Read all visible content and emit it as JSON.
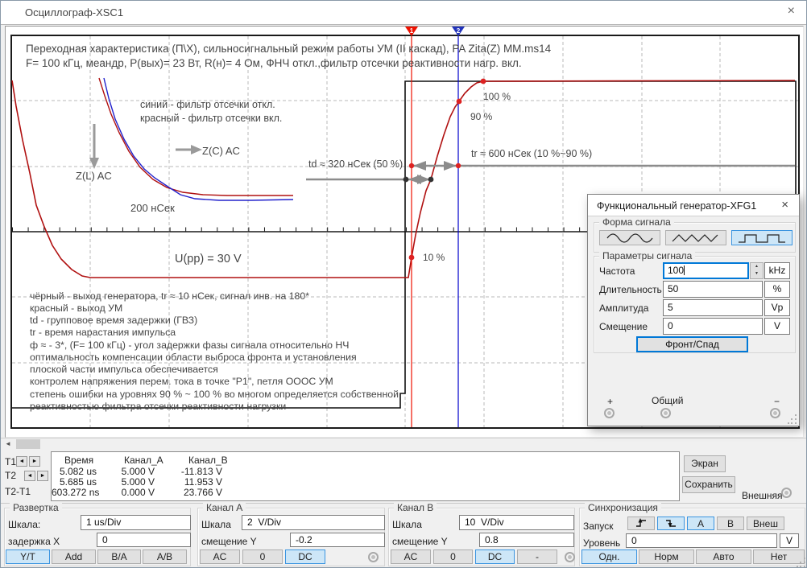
{
  "window": {
    "title": "Осциллограф-XSC1",
    "close": "×"
  },
  "scope": {
    "annotations": {
      "title_line1": "Переходная характеристика (П\\Х), сильносигнальный режим работы УМ (II каскад), PA Zita(Z) MM.ms14",
      "title_line2": "F= 100 кГц, меандр, P(вых)= 23 Вт, R(н)= 4 Ом, ФНЧ откл.,фильтр отсечки реактивности нагр. вкл.",
      "legend_blue": "синий - фильтр отсечки откл.",
      "legend_red": "красный - фильтр отсечки вкл.",
      "zc_label": "Z(C) AC",
      "zl_label": "Z(L) AC",
      "inset_time": "200 нСек",
      "td_label": "td ≈ 320 нСек (50 %)",
      "tr_label": "tr ≈ 600 нСек (10 %~90 %)",
      "p100": "100 %",
      "p90": "90 %",
      "p10": "10 %",
      "upp": "U(pp) = 30 V",
      "notes": [
        "чёрный - выход генератора, tr ≈ 10 нСек, сигнал инв. на 180*",
        "красный - выход УМ",
        "td - групповое время задержки (ГВЗ)",
        "tr - время нарастания импульса",
        "ф ≈ - 3*, (F= 100 кГц) - угол задержки фазы сигнала относительно НЧ",
        "оптимальность компенсации области выброса фронта и установления",
        "плоской части импульса обеспечивается",
        "контролем напряжения перем. тока в точке \"P1\", петля ОООС УМ",
        "степень ошибки на уровнях 90 % ~ 100 % во многом определяется собственной",
        "реактивностью фильтра отсечки реактивности нагрузки"
      ]
    },
    "cursors": {
      "c1": "1",
      "c2": "2"
    }
  },
  "measurements": {
    "headers": [
      "Время",
      "Канал_A",
      "Канал_B"
    ],
    "row_labels": [
      "T1",
      "T2",
      "T2-T1"
    ],
    "rows": [
      {
        "time": "5.082 us",
        "a": "5.000 V",
        "b": "-11.813 V"
      },
      {
        "time": "5.685 us",
        "a": "5.000 V",
        "b": "11.953 V"
      },
      {
        "time": "603.272 ns",
        "a": "0.000 V",
        "b": "23.766 V"
      }
    ],
    "screen_button": "Экран",
    "save_button": "Сохранить",
    "external_label": "Внешняя"
  },
  "timebase": {
    "group": "Развертка",
    "scale_label": "Шкала:",
    "scale_value": "1 us/Div",
    "xpos_label": "задержка X",
    "xpos_value": "0",
    "buttons": [
      "Y/T",
      "Add",
      "B/A",
      "A/B"
    ]
  },
  "channel_a": {
    "group": "Канал А",
    "scale_label": "Шкала",
    "scale_value": "2  V/Div",
    "offset_label": "смещение Y",
    "offset_value": "-0.2",
    "buttons": [
      "AC",
      "0",
      "DC"
    ]
  },
  "channel_b": {
    "group": "Канал B",
    "scale_label": "Шкала",
    "scale_value": "10  V/Div",
    "offset_label": "смещение Y",
    "offset_value": "0.8",
    "buttons": [
      "AC",
      "0",
      "DC",
      "-"
    ]
  },
  "trigger": {
    "group": "Синхронизация",
    "start_label": "Запуск",
    "source_buttons": [
      "A",
      "B",
      "Внеш"
    ],
    "level_label": "Уровень",
    "level_value": "0",
    "level_unit": "V",
    "modes": [
      "Одн.",
      "Норм",
      "Авто",
      "Нет"
    ]
  },
  "generator": {
    "title": "Функциональный генератор-XFG1",
    "close": "×",
    "waveform_group": "Форма сигнала",
    "params_group": "Параметры сигнала",
    "rows": [
      {
        "label": "Частота",
        "value": "100",
        "unit": "kHz"
      },
      {
        "label": "Длительность",
        "value": "50",
        "unit": "%"
      },
      {
        "label": "Амплитуда",
        "value": "5",
        "unit": "Vp"
      },
      {
        "label": "Смещение",
        "value": "0",
        "unit": "V"
      }
    ],
    "edge_button": "Фронт/Спад",
    "terminals": {
      "plus": "+",
      "common": "Общий",
      "minus": "−"
    }
  },
  "icons": {
    "scroll_left": "◄",
    "t_left": "◄",
    "t_right": "►",
    "spin_up": "▲",
    "spin_down": "▼",
    "waveforms": [
      "sine-wave",
      "triangle-wave",
      "square-wave"
    ],
    "edges": [
      "rising-edge",
      "falling-edge"
    ]
  },
  "colors": {
    "trace_red": "#b01010",
    "trace_black": "#111111",
    "inset_blue": "#2222cc",
    "cursor1": "#ee1100",
    "cursor2": "#0000cc",
    "dim_gray": "#8c8c8c",
    "selected_bg": "#cde6f7",
    "selected_border": "#3c95e0"
  }
}
